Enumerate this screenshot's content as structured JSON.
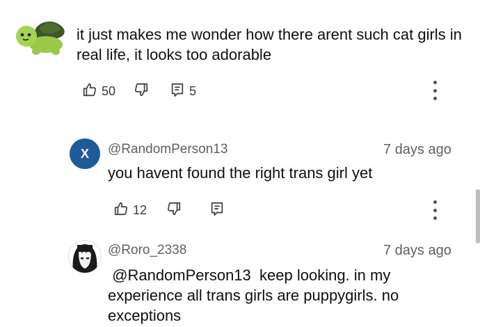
{
  "comment": {
    "text": "it just makes me wonder how there arent such cat girls in real life, it looks too adorable",
    "likes": "50",
    "replies": "5"
  },
  "replies": [
    {
      "handle": "@RandomPerson13",
      "time": "7 days ago",
      "avatar_letter": "X",
      "avatar_color": "#1f5a99",
      "text": "you havent found the right trans girl yet",
      "likes": "12"
    },
    {
      "handle": "@Roro_2338",
      "time": "7 days ago",
      "text": " @RandomPerson13  keep looking. in my experience all trans girls are puppygirls. no exceptions"
    }
  ],
  "icons": {
    "like": "thumbs-up-icon",
    "dislike": "thumbs-down-icon",
    "reply": "reply-icon",
    "more": "more-vert-icon"
  }
}
